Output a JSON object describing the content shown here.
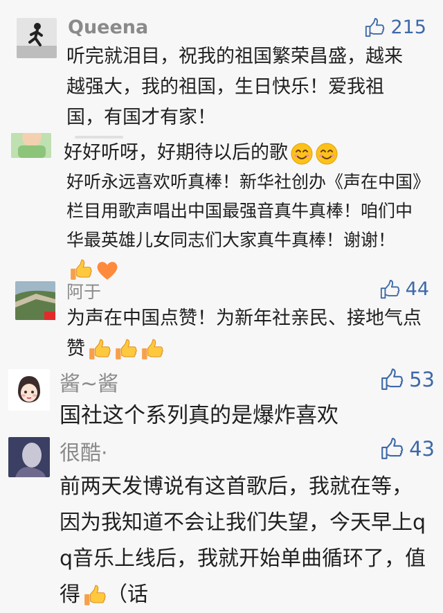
{
  "comments": [
    {
      "user": "Queena",
      "likes": "215",
      "text": "听完就泪目，祝我的祖国繁荣昌盛，越来越强大，我的祖国，生日快乐！爱我祖国，有国才有家！"
    },
    {
      "user": "",
      "likes": "",
      "text": "好好听呀，好期待以后的歌",
      "reply_text": "好听永远喜欢听真棒！新华社创办《声在中国》栏目用歌声唱出中国最强音真牛真棒！咱们中华最英雄儿女同志们大家真牛真棒！谢谢！"
    },
    {
      "user": "阿于",
      "likes": "44",
      "text": "为声在中国点赞！为新年社亲民、接地气点赞"
    },
    {
      "user": "酱~酱",
      "likes": "53",
      "text": "国社这个系列真的是爆炸喜欢"
    },
    {
      "user": "很酷·",
      "likes": "43",
      "text": "前两天发博说有这首歌后，我就在等，因为我知道不会让我们失望，今天早上qq音乐上线后，我就开始单曲循环了，值得",
      "text_tail": "（话"
    }
  ],
  "icons": {
    "like": "thumbs-up-outline-icon",
    "smile": "smiling-face-emoji",
    "thumb": "thumbs-up-emoji",
    "heart": "orange-heart-emoji"
  },
  "colors": {
    "background": "#f7f7f7",
    "username": "#8a8a8a",
    "likes": "#3d69a8",
    "text": "#1f1f1f"
  }
}
